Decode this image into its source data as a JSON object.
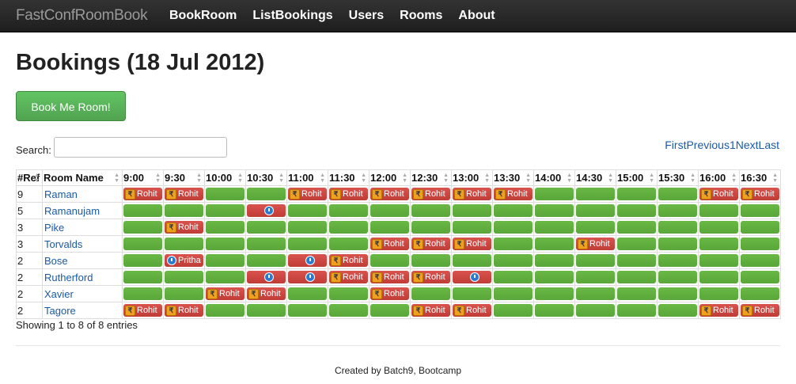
{
  "navbar": {
    "brand": "FastConfRoomBook",
    "items": [
      "BookRoom",
      "ListBookings",
      "Users",
      "Rooms",
      "About"
    ]
  },
  "page_title": "Bookings (18 Jul 2012)",
  "book_button": "Book Me Room!",
  "search": {
    "label": "Search:",
    "value": ""
  },
  "pager": [
    "First",
    "Previous",
    "1",
    "Next",
    "Last"
  ],
  "table": {
    "headers": [
      "#Ref",
      "Room Name"
    ],
    "times": [
      "9:00",
      "9:30",
      "10:00",
      "10:30",
      "11:00",
      "11:30",
      "12:00",
      "12:30",
      "13:00",
      "13:30",
      "14:00",
      "14:30",
      "15:00",
      "15:30",
      "16:00",
      "16:30"
    ],
    "rows": [
      {
        "ref": "9",
        "room": "Raman",
        "slots": [
          "Rohit",
          "Rohit",
          "",
          "",
          "Rohit",
          "Rohit",
          "Rohit",
          "Rohit",
          "Rohit",
          "Rohit",
          "",
          "",
          "",
          "",
          "Rohit",
          "Rohit"
        ]
      },
      {
        "ref": "5",
        "room": "Ramanujam",
        "slots": [
          "",
          "",
          "",
          "@",
          "",
          "",
          "",
          "",
          "",
          "",
          "",
          "",
          "",
          "",
          "",
          ""
        ]
      },
      {
        "ref": "3",
        "room": "Pike",
        "slots": [
          "",
          "Rohit",
          "",
          "",
          "",
          "",
          "",
          "",
          "",
          "",
          "",
          "",
          "",
          "",
          "",
          ""
        ]
      },
      {
        "ref": "3",
        "room": "Torvalds",
        "slots": [
          "",
          "",
          "",
          "",
          "",
          "",
          "Rohit",
          "Rohit",
          "Rohit",
          "",
          "",
          "Rohit",
          "",
          "",
          "",
          ""
        ]
      },
      {
        "ref": "2",
        "room": "Bose",
        "slots": [
          "",
          "@Pritha",
          "",
          "",
          "@",
          "Rohit",
          "",
          "",
          "",
          "",
          "",
          "",
          "",
          "",
          "",
          ""
        ]
      },
      {
        "ref": "2",
        "room": "Rutherford",
        "slots": [
          "",
          "",
          "",
          "@",
          "@",
          "Rohit",
          "Rohit",
          "Rohit",
          "@",
          "",
          "",
          "",
          "",
          "",
          "",
          ""
        ]
      },
      {
        "ref": "2",
        "room": "Xavier",
        "slots": [
          "",
          "",
          "Rohit",
          "Rohit",
          "",
          "",
          "Rohit",
          "",
          "",
          "",
          "",
          "",
          "",
          "",
          "",
          ""
        ]
      },
      {
        "ref": "2",
        "room": "Tagore",
        "slots": [
          "Rohit",
          "Rohit",
          "",
          "",
          "",
          "",
          "",
          "Rohit",
          "Rohit",
          "",
          "",
          "",
          "",
          "",
          "Rohit",
          "Rohit"
        ]
      }
    ]
  },
  "rupee_symbol": "₹",
  "info": "Showing 1 to 8 of 8 entries",
  "footer": "Created by Batch9, Bootcamp"
}
